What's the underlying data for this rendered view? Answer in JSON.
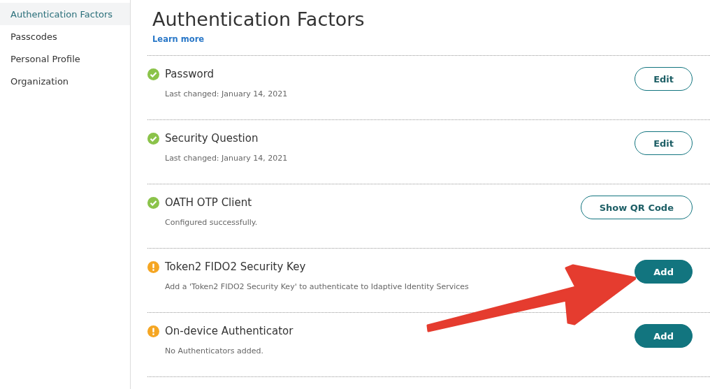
{
  "sidebar": {
    "items": [
      {
        "label": "Authentication Factors",
        "selected": true
      },
      {
        "label": "Passcodes",
        "selected": false
      },
      {
        "label": "Personal Profile",
        "selected": false
      },
      {
        "label": "Organization",
        "selected": false
      }
    ]
  },
  "page": {
    "title": "Authentication Factors",
    "link": "Learn more"
  },
  "factors": [
    {
      "name": "Password",
      "configured": true,
      "description": "Last changed: January 14, 2021",
      "button": {
        "label": "Edit",
        "kind": "outline"
      }
    },
    {
      "name": "Security Question",
      "configured": true,
      "description": "Last changed: January 14, 2021",
      "button": {
        "label": "Edit",
        "kind": "outline"
      }
    },
    {
      "name": "OATH OTP Client",
      "configured": true,
      "description": "Configured successfully.",
      "button": {
        "label": "Show QR Code",
        "kind": "outline"
      }
    },
    {
      "name": "Token2 FIDO2 Security Key",
      "configured": false,
      "description": "Add a 'Token2 FIDO2 Security Key' to authenticate to Idaptive Identity Services",
      "button": {
        "label": "Add",
        "kind": "filled"
      }
    },
    {
      "name": "On-device Authenticator",
      "configured": false,
      "description": "No Authenticators added.",
      "button": {
        "label": "Add",
        "kind": "filled"
      }
    }
  ]
}
